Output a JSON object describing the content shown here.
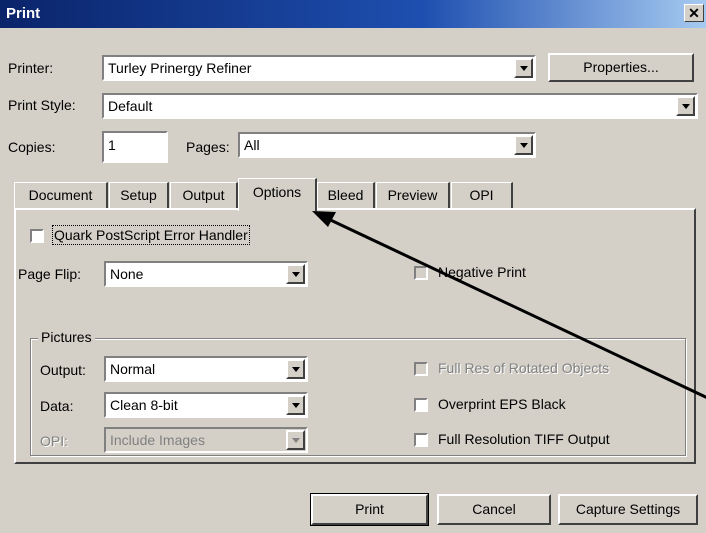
{
  "window": {
    "title": "Print",
    "close_glyph": "✕"
  },
  "printer": {
    "label": "Printer:",
    "value": "Turley Prinergy Refiner",
    "properties_button": "Properties..."
  },
  "print_style": {
    "label": "Print Style:",
    "value": "Default"
  },
  "copies": {
    "label": "Copies:",
    "value": "1"
  },
  "pages": {
    "label": "Pages:",
    "value": "All"
  },
  "tabs": [
    {
      "label": "Document",
      "active": false
    },
    {
      "label": "Setup",
      "active": false
    },
    {
      "label": "Output",
      "active": false
    },
    {
      "label": "Options",
      "active": true
    },
    {
      "label": "Bleed",
      "active": false
    },
    {
      "label": "Preview",
      "active": false
    },
    {
      "label": "OPI",
      "active": false
    }
  ],
  "options": {
    "quark_error_handler": {
      "label": "Quark PostScript Error Handler",
      "checked": false
    },
    "page_flip": {
      "label": "Page Flip:",
      "value": "None"
    },
    "negative_print": {
      "label": "Negative Print",
      "checked": false,
      "enabled": false
    },
    "pictures": {
      "legend": "Pictures",
      "output": {
        "label": "Output:",
        "value": "Normal"
      },
      "data": {
        "label": "Data:",
        "value": "Clean 8-bit"
      },
      "opi": {
        "label": "OPI:",
        "value": "Include Images",
        "enabled": false
      },
      "full_res_rotated": {
        "label": "Full Res of Rotated Objects",
        "checked": false,
        "enabled": false
      },
      "overprint_eps_black": {
        "label": "Overprint EPS Black",
        "checked": false
      },
      "full_res_tiff": {
        "label": "Full Resolution TIFF Output",
        "checked": false
      }
    }
  },
  "buttons": {
    "print": "Print",
    "cancel": "Cancel",
    "capture": "Capture Settings"
  },
  "annotation": {
    "color": "#000000"
  }
}
